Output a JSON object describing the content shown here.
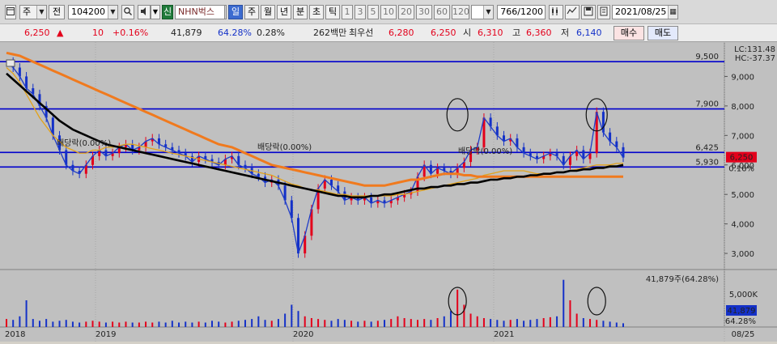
{
  "toolbar": {
    "period_tabs": [
      "주",
      "전"
    ],
    "stock_code": "104200",
    "market_badge": "신",
    "stock_name": "NHN벅스",
    "intervals": [
      "일",
      "주",
      "월",
      "년",
      "분",
      "초",
      "틱"
    ],
    "active_interval": "일",
    "numbers": [
      "1",
      "3",
      "5",
      "10",
      "20",
      "30",
      "60",
      "120"
    ],
    "count_display": "766",
    "count_total": "/1200",
    "date": "2021/08/25"
  },
  "quote": {
    "price": "6,250",
    "change_arrow": "▲",
    "change": "10",
    "change_pct": "+0.16%",
    "volume": "41,879",
    "volume_ratio": "64.28%",
    "turnover": "0.28%",
    "amount": "262백만",
    "best_ask_label": "최우선",
    "best_ask": "6,280",
    "best_bid": "6,250",
    "open_label": "시",
    "open": "6,310",
    "high_label": "고",
    "high": "6,360",
    "low_label": "저",
    "low": "6,140",
    "buy_label": "매수",
    "sell_label": "매도"
  },
  "price_pane": {
    "lc_label": "LC:131.48",
    "hc_label": "HC:-37.37",
    "y_ticks": [
      "9,000",
      "8,000",
      "7,000",
      "6,000",
      "5,000",
      "4,000",
      "3,000"
    ],
    "hline_labels": [
      "9,500",
      "7,900",
      "6,425",
      "5,930"
    ],
    "current_price_tag": "6,250",
    "current_change_tag": "0.16%",
    "dividend_labels": [
      "배당락(0.00%)",
      "배당락(0.00%)",
      "배당락(0.00%)"
    ]
  },
  "volume_pane": {
    "header": "41,879주(64.28%)",
    "y_tick": "5,000K",
    "current_volume_tag": "41,879",
    "current_ratio_tag": "64.28%"
  },
  "x_axis": [
    "2018",
    "2019",
    "2020",
    "2021",
    "08/25"
  ],
  "colors": {
    "up": "#e3001b",
    "down": "#1431c8",
    "ma_long": "#f07a1e",
    "ma_mid": "#000000",
    "price_line": "#1e3cc8"
  },
  "chart_data": {
    "type": "line",
    "series": [
      {
        "values": [
          9500,
          9300,
          9000,
          8600,
          8400,
          8000,
          7600,
          7000,
          6500,
          6000,
          5800,
          5700,
          6000,
          6300,
          6500,
          6300,
          6400,
          6600,
          6700,
          6500,
          6600,
          6800,
          6900,
          6700,
          6600,
          6500,
          6400,
          6300,
          6100,
          6300,
          6200,
          6100,
          6000,
          6200,
          6300,
          6000,
          5900,
          5700,
          5600,
          5400,
          5500,
          5300,
          4800,
          4200,
          3000,
          3600,
          4500,
          5200,
          5500,
          5300,
          5100,
          4800,
          4900,
          4800,
          4900,
          4700,
          4800,
          4700,
          4800,
          4900,
          5000,
          5100,
          5600,
          6000,
          5700,
          5900,
          5800,
          5700,
          5900,
          6100,
          6500,
          6600,
          7600,
          7300,
          7000,
          6800,
          6900,
          6600,
          6400,
          6300,
          6200,
          6300,
          6400,
          6300,
          6000,
          6300,
          6500,
          6200,
          6400,
          7800,
          7100,
          6800,
          6600,
          6250
        ]
      },
      {
        "values": [
          9300,
          9100,
          8800,
          8400,
          8000,
          7600,
          7300,
          7000,
          6800,
          6600,
          6500,
          6400,
          6400,
          6500,
          6500,
          6600,
          6600,
          6650,
          6700,
          6700,
          6650,
          6600,
          6550,
          6500,
          6450,
          6400,
          6350,
          6300,
          6250,
          6200,
          6150,
          6100,
          6050,
          6000,
          5950,
          5900,
          5850,
          5800,
          5750,
          5700,
          5650,
          5550,
          5450,
          5350,
          5300,
          5200,
          5150,
          5150,
          5100,
          5050,
          5000,
          5000,
          4950,
          4950,
          4950,
          4950,
          4950,
          4950,
          4950,
          5000,
          5000,
          5050,
          5100,
          5150,
          5200,
          5250,
          5300,
          5350,
          5400,
          5450,
          5500,
          5550,
          5650,
          5700,
          5750,
          5800,
          5800,
          5800,
          5800,
          5750,
          5700,
          5700,
          5700,
          5750,
          5750,
          5800,
          5850,
          5900,
          5950,
          6000,
          6000,
          6000,
          6050,
          6050
        ]
      },
      {
        "values": [
          9800,
          9750,
          9700,
          9600,
          9500,
          9400,
          9300,
          9200,
          9100,
          9000,
          8900,
          8800,
          8700,
          8600,
          8500,
          8400,
          8300,
          8200,
          8100,
          8000,
          7900,
          7800,
          7700,
          7600,
          7500,
          7400,
          7300,
          7200,
          7100,
          7000,
          6900,
          6800,
          6700,
          6650,
          6600,
          6500,
          6400,
          6300,
          6200,
          6100,
          6000,
          5950,
          5900,
          5850,
          5800,
          5750,
          5700,
          5650,
          5600,
          5550,
          5500,
          5450,
          5400,
          5350,
          5300,
          5300,
          5300,
          5300,
          5350,
          5400,
          5450,
          5500,
          5500,
          5550,
          5600,
          5650,
          5700,
          5700,
          5700,
          5650,
          5650,
          5600,
          5600,
          5600,
          5600,
          5600,
          5600,
          5600,
          5600,
          5600,
          5600,
          5600,
          5600,
          5600,
          5600,
          5600,
          5600,
          5600,
          5600,
          5600,
          5600,
          5600,
          5600,
          5600
        ]
      },
      {
        "values": [
          9100,
          8900,
          8700,
          8500,
          8300,
          8100,
          7900,
          7700,
          7500,
          7350,
          7200,
          7100,
          7000,
          6900,
          6800,
          6700,
          6650,
          6600,
          6550,
          6500,
          6450,
          6400,
          6350,
          6300,
          6250,
          6200,
          6150,
          6100,
          6050,
          6000,
          5950,
          5900,
          5850,
          5800,
          5750,
          5700,
          5650,
          5600,
          5550,
          5500,
          5450,
          5400,
          5350,
          5300,
          5250,
          5200,
          5150,
          5100,
          5050,
          5000,
          4950,
          4950,
          4900,
          4900,
          4900,
          4950,
          4950,
          5000,
          5000,
          5050,
          5100,
          5150,
          5200,
          5200,
          5250,
          5250,
          5300,
          5300,
          5350,
          5350,
          5400,
          5400,
          5450,
          5500,
          5500,
          5550,
          5550,
          5600,
          5600,
          5650,
          5650,
          5700,
          5700,
          5750,
          5750,
          5800,
          5800,
          5850,
          5850,
          5900,
          5900,
          5950,
          5950,
          6000
        ]
      }
    ],
    "volume": [
      900,
      800,
      1200,
      3000,
      900,
      700,
      900,
      600,
      700,
      800,
      600,
      500,
      600,
      700,
      600,
      500,
      600,
      500,
      600,
      500,
      500,
      600,
      500,
      600,
      500,
      700,
      500,
      600,
      500,
      600,
      500,
      700,
      600,
      500,
      600,
      700,
      800,
      900,
      1200,
      800,
      700,
      900,
      1500,
      2500,
      1800,
      1200,
      1000,
      900,
      800,
      700,
      900,
      800,
      700,
      600,
      700,
      600,
      700,
      800,
      900,
      1200,
      1000,
      900,
      800,
      900,
      800,
      1000,
      1200,
      1800,
      4200,
      2500,
      1500,
      1200,
      1000,
      900,
      800,
      700,
      800,
      900,
      700,
      800,
      900,
      1000,
      1100,
      1200,
      5300,
      3000,
      1500,
      1000,
      900,
      800,
      700,
      600,
      500,
      420
    ],
    "ylim": [
      2700,
      10000
    ],
    "hlines": [
      9500,
      7900,
      6425,
      5930
    ],
    "ellipses_at": [
      [
        68,
        7700
      ],
      [
        89,
        7700
      ]
    ]
  }
}
